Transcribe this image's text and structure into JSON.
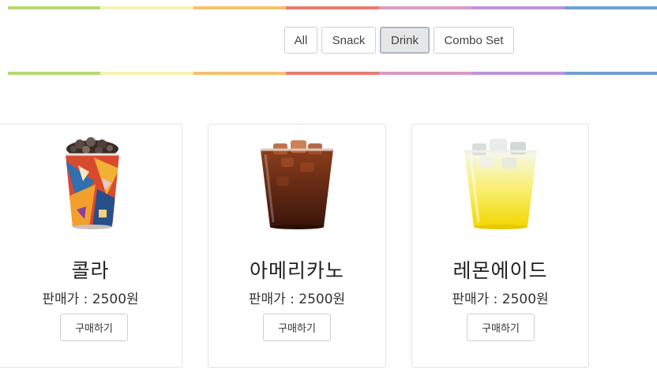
{
  "rainbow_colors": [
    "#b8d876",
    "#f6f2b4",
    "#f6c06e",
    "#e77c6e",
    "#d89bc3",
    "#bd95d8",
    "#6fa0d6"
  ],
  "filters": [
    {
      "label": "All",
      "active": false
    },
    {
      "label": "Snack",
      "active": false
    },
    {
      "label": "Drink",
      "active": true
    },
    {
      "label": "Combo Set",
      "active": false
    }
  ],
  "products": [
    {
      "name": "콜라",
      "price_label": "판매가 : 2500원",
      "buy_label": "구매하기",
      "image": "cola-cup-icon"
    },
    {
      "name": "아메리카노",
      "price_label": "판매가 : 2500원",
      "buy_label": "구매하기",
      "image": "americano-cup-icon"
    },
    {
      "name": "레몬에이드",
      "price_label": "판매가 : 2500원",
      "buy_label": "구매하기",
      "image": "lemonade-cup-icon"
    }
  ]
}
